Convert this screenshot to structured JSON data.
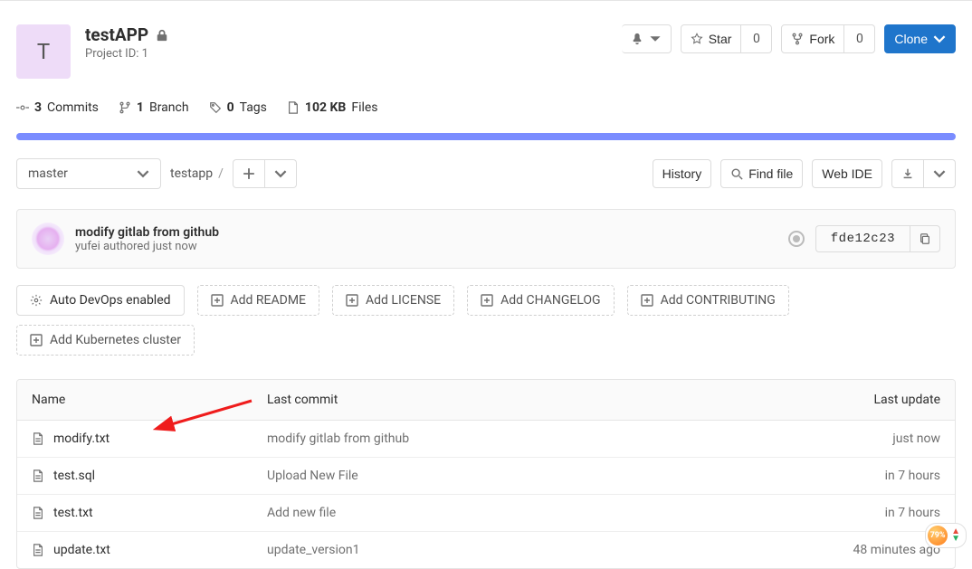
{
  "project": {
    "avatar_letter": "T",
    "name": "testAPP",
    "id_line": "Project ID: 1"
  },
  "actions": {
    "star_label": "Star",
    "star_count": "0",
    "fork_label": "Fork",
    "fork_count": "0",
    "clone_label": "Clone"
  },
  "stats": {
    "commits_n": "3",
    "commits_label": "Commits",
    "branches_n": "1",
    "branches_label": "Branch",
    "tags_n": "0",
    "tags_label": "Tags",
    "size_n": "102 KB",
    "size_label": "Files"
  },
  "toolbar": {
    "branch": "master",
    "breadcrumb_root": "testapp",
    "history_label": "History",
    "findfile_label": "Find file",
    "webide_label": "Web IDE"
  },
  "commit": {
    "message": "modify gitlab from github",
    "author": "yufei",
    "rest": " authored just now",
    "sha": "fde12c23"
  },
  "pills": {
    "autodevops": "Auto DevOps enabled",
    "readme": "Add README",
    "license": "Add LICENSE",
    "changelog": "Add CHANGELOG",
    "contributing": "Add CONTRIBUTING",
    "k8s": "Add Kubernetes cluster"
  },
  "table": {
    "h_name": "Name",
    "h_commit": "Last commit",
    "h_update": "Last update",
    "rows": [
      {
        "name": "modify.txt",
        "commit": "modify gitlab from github",
        "time": "just now"
      },
      {
        "name": "test.sql",
        "commit": "Upload New File",
        "time": "in 7 hours"
      },
      {
        "name": "test.txt",
        "commit": "Add new file",
        "time": "in 7 hours"
      },
      {
        "name": "update.txt",
        "commit": "update_version1",
        "time": "48 minutes ago"
      }
    ]
  },
  "corner": {
    "pct": "79%"
  }
}
